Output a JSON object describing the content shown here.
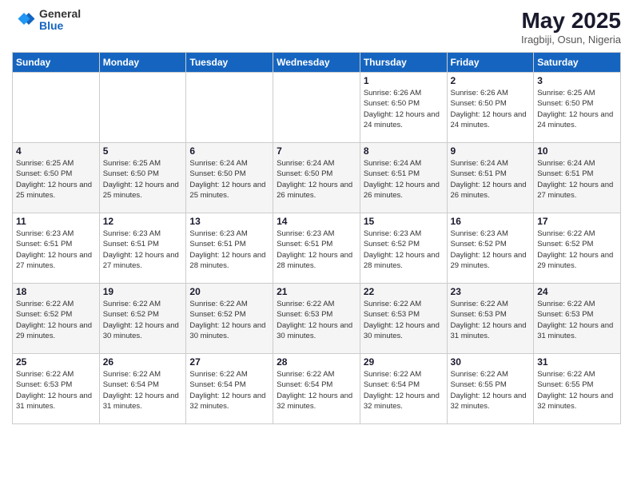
{
  "logo": {
    "general": "General",
    "blue": "Blue"
  },
  "title": "May 2025",
  "subtitle": "Iragbiji, Osun, Nigeria",
  "days_of_week": [
    "Sunday",
    "Monday",
    "Tuesday",
    "Wednesday",
    "Thursday",
    "Friday",
    "Saturday"
  ],
  "weeks": [
    [
      {
        "day": "",
        "info": ""
      },
      {
        "day": "",
        "info": ""
      },
      {
        "day": "",
        "info": ""
      },
      {
        "day": "",
        "info": ""
      },
      {
        "day": "1",
        "info": "Sunrise: 6:26 AM\nSunset: 6:50 PM\nDaylight: 12 hours\nand 24 minutes."
      },
      {
        "day": "2",
        "info": "Sunrise: 6:26 AM\nSunset: 6:50 PM\nDaylight: 12 hours\nand 24 minutes."
      },
      {
        "day": "3",
        "info": "Sunrise: 6:25 AM\nSunset: 6:50 PM\nDaylight: 12 hours\nand 24 minutes."
      }
    ],
    [
      {
        "day": "4",
        "info": "Sunrise: 6:25 AM\nSunset: 6:50 PM\nDaylight: 12 hours\nand 25 minutes."
      },
      {
        "day": "5",
        "info": "Sunrise: 6:25 AM\nSunset: 6:50 PM\nDaylight: 12 hours\nand 25 minutes."
      },
      {
        "day": "6",
        "info": "Sunrise: 6:24 AM\nSunset: 6:50 PM\nDaylight: 12 hours\nand 25 minutes."
      },
      {
        "day": "7",
        "info": "Sunrise: 6:24 AM\nSunset: 6:50 PM\nDaylight: 12 hours\nand 26 minutes."
      },
      {
        "day": "8",
        "info": "Sunrise: 6:24 AM\nSunset: 6:51 PM\nDaylight: 12 hours\nand 26 minutes."
      },
      {
        "day": "9",
        "info": "Sunrise: 6:24 AM\nSunset: 6:51 PM\nDaylight: 12 hours\nand 26 minutes."
      },
      {
        "day": "10",
        "info": "Sunrise: 6:24 AM\nSunset: 6:51 PM\nDaylight: 12 hours\nand 27 minutes."
      }
    ],
    [
      {
        "day": "11",
        "info": "Sunrise: 6:23 AM\nSunset: 6:51 PM\nDaylight: 12 hours\nand 27 minutes."
      },
      {
        "day": "12",
        "info": "Sunrise: 6:23 AM\nSunset: 6:51 PM\nDaylight: 12 hours\nand 27 minutes."
      },
      {
        "day": "13",
        "info": "Sunrise: 6:23 AM\nSunset: 6:51 PM\nDaylight: 12 hours\nand 28 minutes."
      },
      {
        "day": "14",
        "info": "Sunrise: 6:23 AM\nSunset: 6:51 PM\nDaylight: 12 hours\nand 28 minutes."
      },
      {
        "day": "15",
        "info": "Sunrise: 6:23 AM\nSunset: 6:52 PM\nDaylight: 12 hours\nand 28 minutes."
      },
      {
        "day": "16",
        "info": "Sunrise: 6:23 AM\nSunset: 6:52 PM\nDaylight: 12 hours\nand 29 minutes."
      },
      {
        "day": "17",
        "info": "Sunrise: 6:22 AM\nSunset: 6:52 PM\nDaylight: 12 hours\nand 29 minutes."
      }
    ],
    [
      {
        "day": "18",
        "info": "Sunrise: 6:22 AM\nSunset: 6:52 PM\nDaylight: 12 hours\nand 29 minutes."
      },
      {
        "day": "19",
        "info": "Sunrise: 6:22 AM\nSunset: 6:52 PM\nDaylight: 12 hours\nand 30 minutes."
      },
      {
        "day": "20",
        "info": "Sunrise: 6:22 AM\nSunset: 6:52 PM\nDaylight: 12 hours\nand 30 minutes."
      },
      {
        "day": "21",
        "info": "Sunrise: 6:22 AM\nSunset: 6:53 PM\nDaylight: 12 hours\nand 30 minutes."
      },
      {
        "day": "22",
        "info": "Sunrise: 6:22 AM\nSunset: 6:53 PM\nDaylight: 12 hours\nand 30 minutes."
      },
      {
        "day": "23",
        "info": "Sunrise: 6:22 AM\nSunset: 6:53 PM\nDaylight: 12 hours\nand 31 minutes."
      },
      {
        "day": "24",
        "info": "Sunrise: 6:22 AM\nSunset: 6:53 PM\nDaylight: 12 hours\nand 31 minutes."
      }
    ],
    [
      {
        "day": "25",
        "info": "Sunrise: 6:22 AM\nSunset: 6:53 PM\nDaylight: 12 hours\nand 31 minutes."
      },
      {
        "day": "26",
        "info": "Sunrise: 6:22 AM\nSunset: 6:54 PM\nDaylight: 12 hours\nand 31 minutes."
      },
      {
        "day": "27",
        "info": "Sunrise: 6:22 AM\nSunset: 6:54 PM\nDaylight: 12 hours\nand 32 minutes."
      },
      {
        "day": "28",
        "info": "Sunrise: 6:22 AM\nSunset: 6:54 PM\nDaylight: 12 hours\nand 32 minutes."
      },
      {
        "day": "29",
        "info": "Sunrise: 6:22 AM\nSunset: 6:54 PM\nDaylight: 12 hours\nand 32 minutes."
      },
      {
        "day": "30",
        "info": "Sunrise: 6:22 AM\nSunset: 6:55 PM\nDaylight: 12 hours\nand 32 minutes."
      },
      {
        "day": "31",
        "info": "Sunrise: 6:22 AM\nSunset: 6:55 PM\nDaylight: 12 hours\nand 32 minutes."
      }
    ]
  ]
}
